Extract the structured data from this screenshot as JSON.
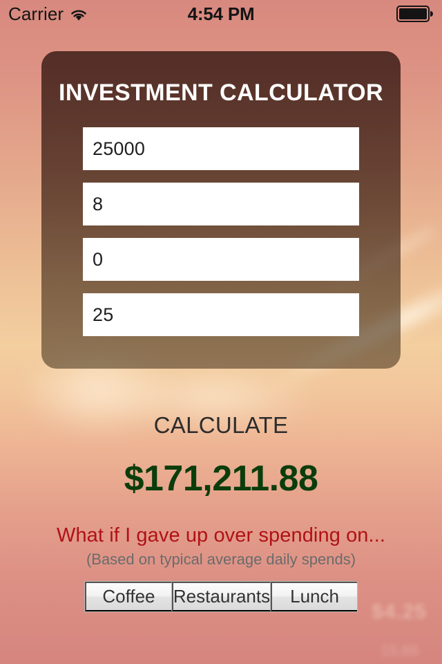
{
  "status_bar": {
    "carrier": "Carrier",
    "wifi_icon": "wifi-icon",
    "time": "4:54 PM",
    "battery_icon": "battery-full-icon"
  },
  "card": {
    "title": "INVESTMENT CALCULATOR",
    "fields": [
      {
        "name": "principal",
        "value": "25000",
        "placeholder": ""
      },
      {
        "name": "rate",
        "value": "8",
        "placeholder": ""
      },
      {
        "name": "compound",
        "value": "0",
        "placeholder": ""
      },
      {
        "name": "years",
        "value": "25",
        "placeholder": ""
      }
    ]
  },
  "actions": {
    "calculate_label": "CALCULATE"
  },
  "result": {
    "amount": "$171,211.88",
    "amount_color": "#0b3d0b"
  },
  "prompt": {
    "heading": "What if I gave up over spending on...",
    "heading_color": "#b01217",
    "subheading": "(Based on typical average daily spends)"
  },
  "segmented_control": {
    "segments": [
      {
        "label": "Coffee"
      },
      {
        "label": "Restaurants"
      },
      {
        "label": "Lunch"
      }
    ]
  },
  "background": {
    "ghost_text_1": "$4.25",
    "ghost_text_2": "15.65"
  }
}
